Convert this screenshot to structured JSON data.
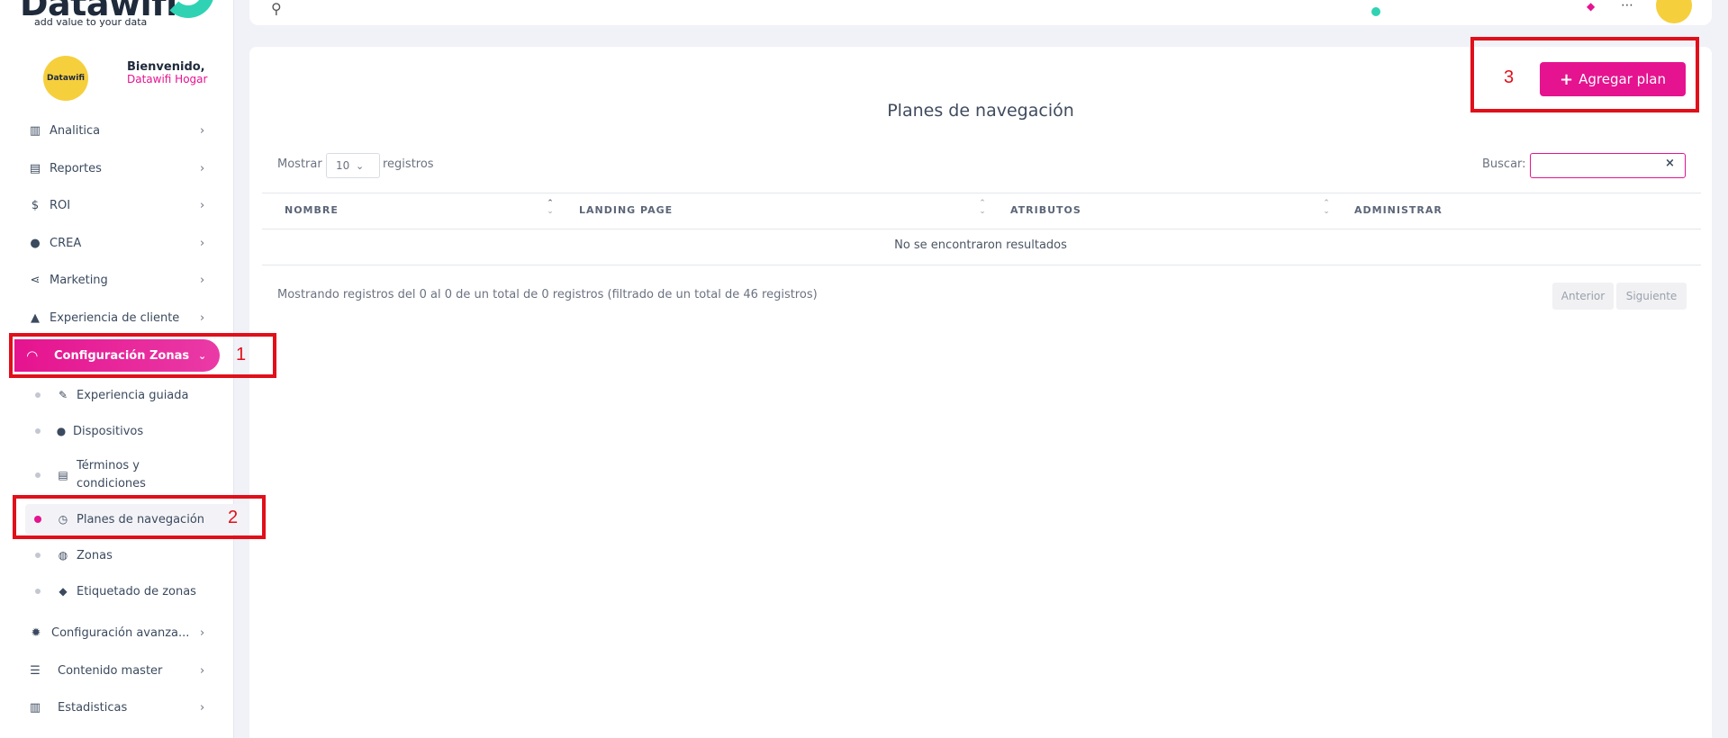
{
  "brand": {
    "name": "Datawifi",
    "tagline": "add value to your data"
  },
  "profile": {
    "avatar_text": "Datawifi",
    "welcome": "Bienvenido,",
    "name": "Datawifi Hogar"
  },
  "sidebar": {
    "items": [
      {
        "label": "Analitica",
        "icon": "bar-chart-icon"
      },
      {
        "label": "Reportes",
        "icon": "document-icon"
      },
      {
        "label": "ROI",
        "icon": "money-icon"
      },
      {
        "label": "CREA",
        "icon": "lightbulb-icon"
      },
      {
        "label": "Marketing",
        "icon": "share-icon"
      },
      {
        "label": "Experiencia de cliente",
        "icon": "thumbs-up-icon"
      }
    ],
    "active_section": {
      "label": "Configuración Zonas",
      "icon": "wifi-icon"
    },
    "sub_items": [
      {
        "label": "Experiencia guiada",
        "icon": "magic-wand-icon"
      },
      {
        "label": "Dispositivos",
        "icon": "map-pin-icon"
      },
      {
        "label": "Términos y condiciones",
        "icon": "file-check-icon"
      },
      {
        "label": "Planes de navegación",
        "icon": "clock-icon",
        "active": true
      },
      {
        "label": "Zonas",
        "icon": "globe-icon"
      },
      {
        "label": "Etiquetado de zonas",
        "icon": "tags-icon"
      }
    ],
    "bottom_items": [
      {
        "label": "Configuración avanza...",
        "icon": "gear-icon"
      },
      {
        "label": "Contenido master",
        "icon": "list-icon"
      },
      {
        "label": "Estadisticas",
        "icon": "bar-chart-icon"
      }
    ]
  },
  "annotations": [
    "1",
    "2",
    "3"
  ],
  "main": {
    "title": "Planes de navegación",
    "add_button": "Agregar plan",
    "show_label": "Mostrar",
    "show_value": "10",
    "show_suffix": "registros",
    "search_label": "Buscar:",
    "search_value": "",
    "columns": [
      "NOMBRE",
      "LANDING PAGE",
      "ATRIBUTOS",
      "ADMINISTRAR"
    ],
    "empty_message": "No se encontraron resultados",
    "info": "Mostrando registros del 0 al 0 de un total de 0 registros (filtrado de un total de 46 registros)",
    "prev": "Anterior",
    "next": "Siguiente"
  },
  "colors": {
    "accent": "#e5138f",
    "teal": "#2fd3b3",
    "annotation_red": "#e10f1a"
  }
}
